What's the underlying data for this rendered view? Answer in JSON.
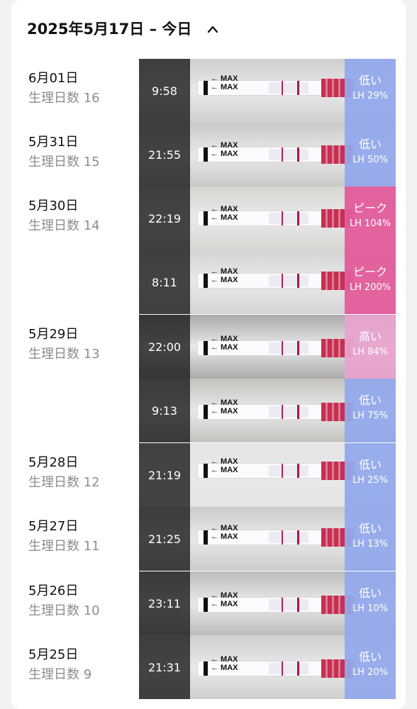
{
  "header": {
    "title": "2025年5月17日 – 今日"
  },
  "entries": [
    {
      "date": "6月01日",
      "cycle": "生理日数 16",
      "time": "9:58",
      "level": "低い",
      "lh": "LH 29%",
      "status": "low",
      "bg": "#cfcfcf"
    },
    {
      "date": "5月31日",
      "cycle": "生理日数 15",
      "time": "21:55",
      "level": "低い",
      "lh": "LH 50%",
      "status": "low",
      "bg": "#c9c9c9"
    },
    {
      "date": "5月30日",
      "cycle": "生理日数 14",
      "time": "22:19",
      "level": "ピーク",
      "lh": "LH 104%",
      "status": "peak",
      "bg": "#d8d6d2"
    },
    {
      "date": "",
      "cycle": "",
      "time": "8:11",
      "level": "ピーク",
      "lh": "LH 200%",
      "status": "peak",
      "bg": "#d4d4d4"
    },
    {
      "date": "5月29日",
      "cycle": "生理日数 13",
      "time": "22:00",
      "level": "高い",
      "lh": "LH 84%",
      "status": "high",
      "bg": "#a9aaa9"
    },
    {
      "date": "",
      "cycle": "",
      "time": "9:13",
      "level": "低い",
      "lh": "LH 75%",
      "status": "low",
      "bg": "#c3c2be"
    },
    {
      "date": "5月28日",
      "cycle": "生理日数 12",
      "time": "21:19",
      "level": "低い",
      "lh": "LH 25%",
      "status": "low",
      "bg": "#e3e4e6"
    },
    {
      "date": "5月27日",
      "cycle": "生理日数 11",
      "time": "21:25",
      "level": "低い",
      "lh": "LH 13%",
      "status": "low",
      "bg": "#cbcbcb"
    },
    {
      "date": "5月26日",
      "cycle": "生理日数 10",
      "time": "23:11",
      "level": "低い",
      "lh": "LH 10%",
      "status": "low",
      "bg": "#bcbcbc"
    },
    {
      "date": "5月25日",
      "cycle": "生理日数 9",
      "time": "21:31",
      "level": "低い",
      "lh": "LH 20%",
      "status": "low",
      "bg": "#cfcfcf"
    }
  ],
  "strip_labels": {
    "max": "← MAX",
    "lh": "LH"
  },
  "colors": {
    "low": "#92a8ec",
    "peak": "#e25c9a",
    "high": "#e7a3cd"
  }
}
